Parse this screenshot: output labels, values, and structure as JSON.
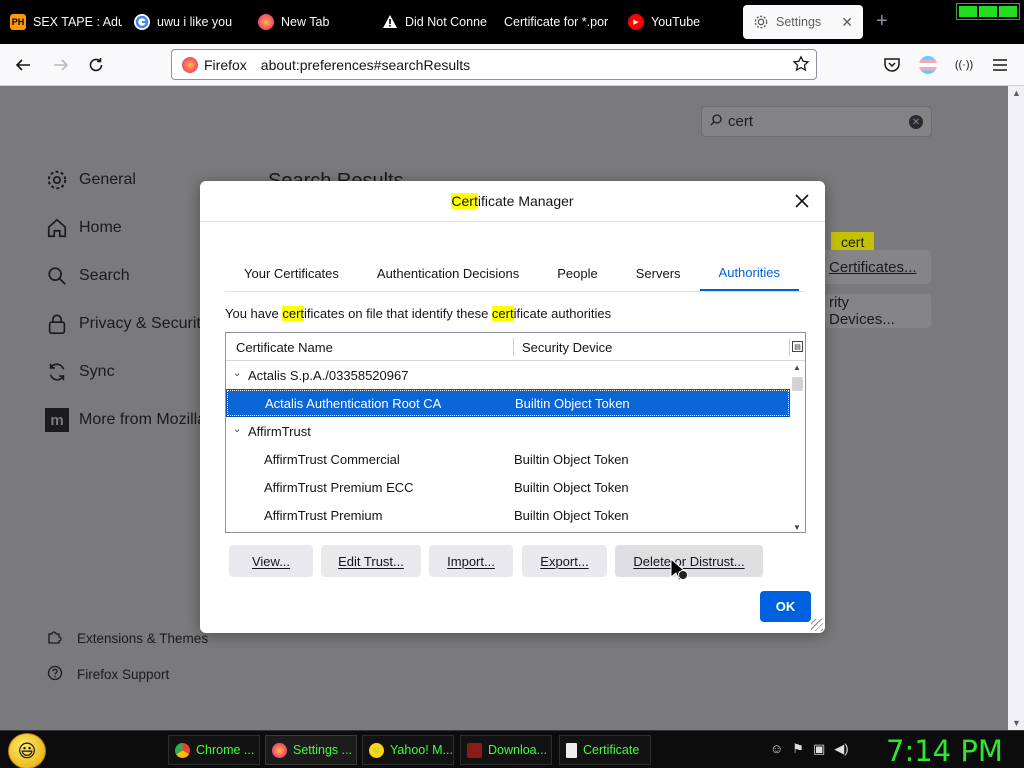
{
  "tabs": [
    {
      "label": "SEX TAPE : Adu",
      "favicon": "ph-icon",
      "color": "#ff9900"
    },
    {
      "label": "uwu i like you",
      "favicon": "google-icon",
      "color": "#4285f4"
    },
    {
      "label": "New Tab",
      "favicon": "firefox-icon",
      "color": "#ff7139"
    },
    {
      "label": "Did Not Conne",
      "favicon": "warning-icon",
      "color": "#ffffff"
    },
    {
      "label": "Certificate for *.por",
      "favicon": "",
      "color": ""
    },
    {
      "label": "YouTube",
      "favicon": "youtube-icon",
      "color": "#ff0000"
    },
    {
      "label": "Settings",
      "favicon": "gear-icon",
      "color": "#5b5b66"
    }
  ],
  "urlbar": {
    "identity": "Firefox",
    "url": "about:preferences#searchResults"
  },
  "prefs": {
    "search_value": "cert",
    "sidebar": [
      {
        "label": "General",
        "icon": "gear-icon"
      },
      {
        "label": "Home",
        "icon": "home-icon"
      },
      {
        "label": "Search",
        "icon": "search-icon"
      },
      {
        "label": "Privacy & Security",
        "icon": "lock-icon"
      },
      {
        "label": "Sync",
        "icon": "sync-icon"
      },
      {
        "label": "More from Mozilla",
        "icon": "mozilla-icon"
      }
    ],
    "footer": [
      {
        "label": "Extensions & Themes",
        "icon": "puzzle-icon"
      },
      {
        "label": "Firefox Support",
        "icon": "help-icon"
      }
    ],
    "results_title": "Search Results",
    "highlight_tag": "cert",
    "view_certs_button": "Certificates...",
    "security_devices_button": "rity Devices..."
  },
  "dialog": {
    "title_highlight": "Cert",
    "title_rest": "ificate Manager",
    "tabs": [
      "Your Certificates",
      "Authentication Decisions",
      "People",
      "Servers",
      "Authorities"
    ],
    "selected_tab": "Authorities",
    "desc": {
      "p1": "You have ",
      "h1": "cert",
      "p2": "ificates on file that identify these ",
      "h2": "cert",
      "p3": "ificate authorities"
    },
    "columns": [
      "Certificate Name",
      "Security Device"
    ],
    "rows": [
      {
        "type": "group",
        "name": "Actalis S.p.A./03358520967",
        "device": ""
      },
      {
        "type": "item",
        "name": "Actalis Authentication Root CA",
        "device": "Builtin Object Token",
        "selected": true
      },
      {
        "type": "group",
        "name": "AffirmTrust",
        "device": ""
      },
      {
        "type": "item",
        "name": "AffirmTrust Commercial",
        "device": "Builtin Object Token"
      },
      {
        "type": "item",
        "name": "AffirmTrust Premium ECC",
        "device": "Builtin Object Token"
      },
      {
        "type": "item",
        "name": "AffirmTrust Premium",
        "device": "Builtin Object Token"
      }
    ],
    "buttons": {
      "view": "View...",
      "edit_trust": "Edit Trust...",
      "import": "Import...",
      "export": "Export...",
      "delete": "Delete or Distrust...",
      "ok": "OK"
    }
  },
  "taskbar": {
    "items": [
      {
        "label": "Chrome ...",
        "icon": "chrome-icon"
      },
      {
        "label": "Settings ...",
        "icon": "firefox-icon"
      },
      {
        "label": "Yahoo! M...",
        "icon": "yahoo-messenger-icon"
      },
      {
        "label": "Downloa...",
        "icon": "download-icon"
      },
      {
        "label": "Certificate",
        "icon": "document-icon"
      }
    ],
    "clock": "7:14 PM"
  },
  "colors": {
    "accent": "#0061e0",
    "highlight": "#ffff00",
    "taskbar_text": "#3cff3c"
  }
}
